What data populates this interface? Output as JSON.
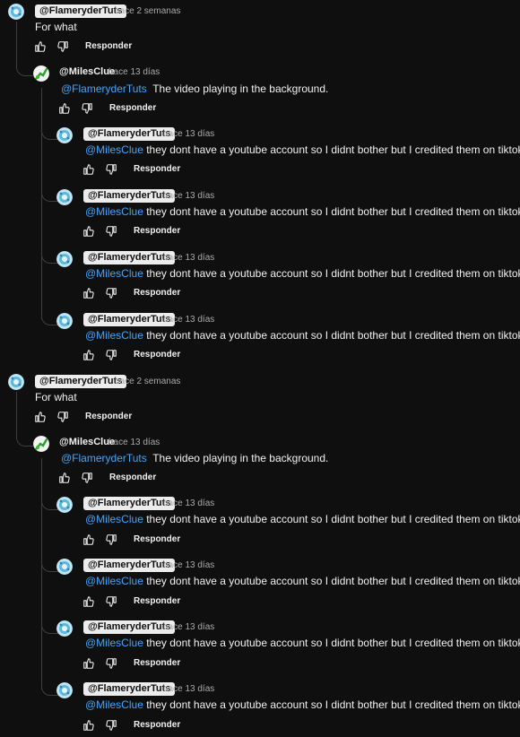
{
  "labels": {
    "reply": "Responder"
  },
  "threads": [
    {
      "comment": {
        "author": "@FlameryderTuts",
        "time": "hace 2 semanas",
        "text": "For what"
      },
      "reply": {
        "author": "@MilesClue",
        "time": "hace 13 días",
        "mention": "@FlameryderTuts",
        "text": "The video playing in the background."
      },
      "nested": [
        {
          "author": "@FlameryderTuts",
          "time": "hace 13 días",
          "mention": "@MilesClue",
          "text": "they dont have a youtube account so I didnt bother but I credited them on tiktok"
        },
        {
          "author": "@FlameryderTuts",
          "time": "hace 13 días",
          "mention": "@MilesClue",
          "text": "they dont have a youtube account so I didnt bother but I credited them on tiktok"
        },
        {
          "author": "@FlameryderTuts",
          "time": "hace 13 días",
          "mention": "@MilesClue",
          "text": "they dont have a youtube account so I didnt bother but I credited them on tiktok"
        },
        {
          "author": "@FlameryderTuts",
          "time": "hace 13 días",
          "mention": "@MilesClue",
          "text": "they dont have a youtube account so I didnt bother but I credited them on tiktok"
        }
      ]
    },
    {
      "comment": {
        "author": "@FlameryderTuts",
        "time": "hace 2 semanas",
        "text": "For what"
      },
      "reply": {
        "author": "@MilesClue",
        "time": "hace 13 días",
        "mention": "@FlameryderTuts",
        "text": "The video playing in the background."
      },
      "nested": [
        {
          "author": "@FlameryderTuts",
          "time": "hace 13 días",
          "mention": "@MilesClue",
          "text": "they dont have a youtube account so I didnt bother but I credited them on tiktok"
        },
        {
          "author": "@FlameryderTuts",
          "time": "hace 13 días",
          "mention": "@MilesClue",
          "text": "they dont have a youtube account so I didnt bother but I credited them on tiktok"
        },
        {
          "author": "@FlameryderTuts",
          "time": "hace 13 días",
          "mention": "@MilesClue",
          "text": "they dont have a youtube account so I didnt bother but I credited them on tiktok"
        },
        {
          "author": "@FlameryderTuts",
          "time": "hace 13 días",
          "mention": "@MilesClue",
          "text": "they dont have a youtube account so I didnt bother but I credited them on tiktok"
        }
      ]
    }
  ]
}
